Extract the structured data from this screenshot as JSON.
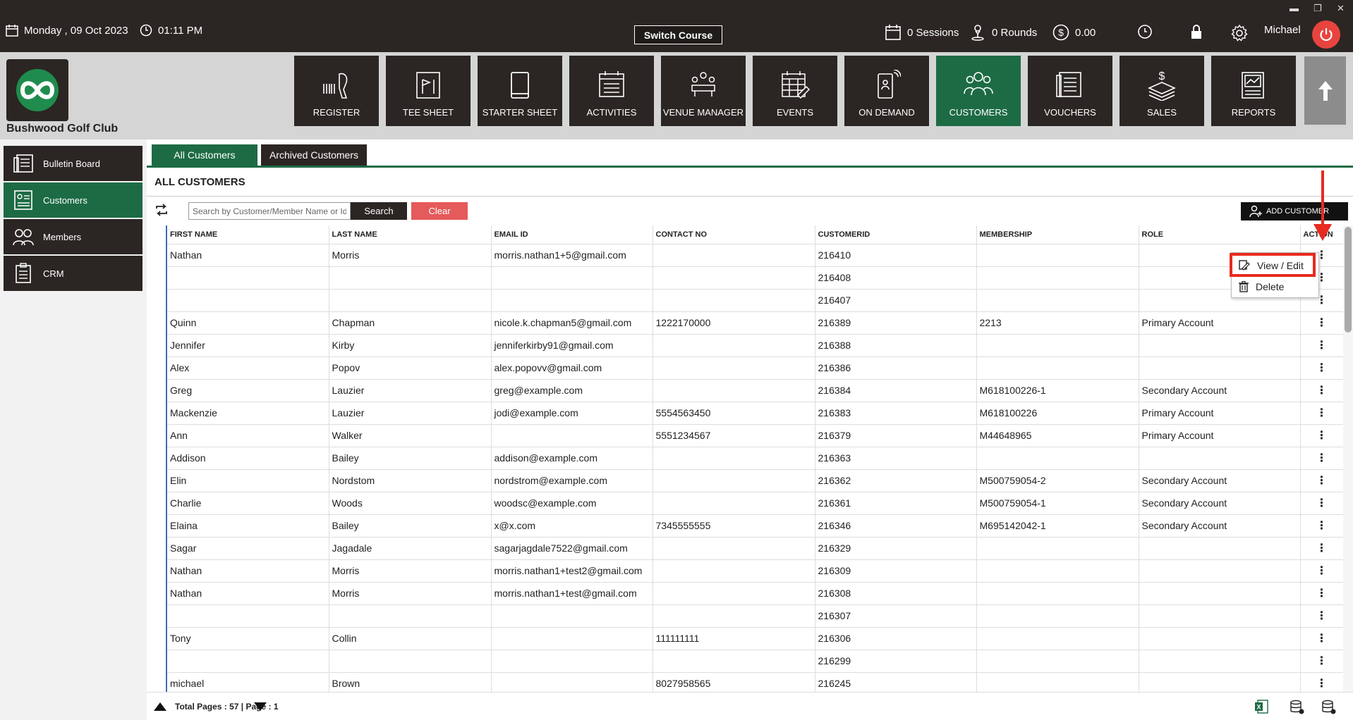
{
  "topbar": {
    "date": "Monday ,  09 Oct 2023",
    "time": "01:11 PM",
    "switch_course": "Switch Course",
    "sessions": "0 Sessions",
    "rounds": "0 Rounds",
    "amount": "0.00",
    "user": "Michael",
    "win_min": "▬",
    "win_restore": "❐",
    "win_close": "✕"
  },
  "club_name": "Bushwood Golf Club",
  "nav": [
    {
      "label": "REGISTER",
      "icon": "barcode-scanner-icon"
    },
    {
      "label": "TEE SHEET",
      "icon": "tee-sheet-icon"
    },
    {
      "label": "STARTER SHEET",
      "icon": "tablet-icon"
    },
    {
      "label": "ACTIVITIES",
      "icon": "calendar-list-icon"
    },
    {
      "label": "VENUE MANAGER",
      "icon": "venue-icon"
    },
    {
      "label": "EVENTS",
      "icon": "events-calendar-icon"
    },
    {
      "label": "ON DEMAND",
      "icon": "phone-icon"
    },
    {
      "label": "CUSTOMERS",
      "icon": "customers-icon",
      "active": true
    },
    {
      "label": "VOUCHERS",
      "icon": "vouchers-icon"
    },
    {
      "label": "SALES",
      "icon": "sales-icon"
    },
    {
      "label": "REPORTS",
      "icon": "reports-icon"
    }
  ],
  "sidebar": {
    "items": [
      {
        "label": "Bulletin Board",
        "icon": "bulletin-icon"
      },
      {
        "label": "Customers",
        "icon": "customers-list-icon",
        "active": true
      },
      {
        "label": "Members",
        "icon": "members-icon"
      },
      {
        "label": "CRM",
        "icon": "crm-icon"
      }
    ]
  },
  "tabs": {
    "all": "All Customers",
    "archived": "Archived Customers"
  },
  "section_title": "ALL CUSTOMERS",
  "search": {
    "placeholder": "Search by Customer/Member Name or Id",
    "button": "Search",
    "clear": "Clear"
  },
  "add_customer": "ADD CUSTOMER",
  "table": {
    "headers": [
      "FIRST NAME",
      "LAST NAME",
      "EMAIL ID",
      "CONTACT NO",
      "CUSTOMERID",
      "MEMBERSHIP",
      "ROLE",
      "ACTION"
    ],
    "rows": [
      [
        "Nathan",
        "Morris",
        "morris.nathan1+5@gmail.com",
        "",
        "216410",
        "",
        ""
      ],
      [
        "",
        "",
        "",
        "",
        "216408",
        "",
        ""
      ],
      [
        "",
        "",
        "",
        "",
        "216407",
        "",
        ""
      ],
      [
        "Quinn",
        "Chapman",
        "nicole.k.chapman5@gmail.com",
        "1222170000",
        "216389",
        "2213",
        "Primary Account"
      ],
      [
        "Jennifer",
        "Kirby",
        "jenniferkirby91@gmail.com",
        "",
        "216388",
        "",
        ""
      ],
      [
        "Alex",
        "Popov",
        "alex.popovv@gmail.com",
        "",
        "216386",
        "",
        ""
      ],
      [
        "Greg",
        "Lauzier",
        "greg@example.com",
        "",
        "216384",
        "M618100226-1",
        "Secondary Account"
      ],
      [
        "Mackenzie",
        "Lauzier",
        "jodi@example.com",
        "5554563450",
        "216383",
        "M618100226",
        "Primary Account"
      ],
      [
        "Ann",
        "Walker",
        "",
        "5551234567",
        "216379",
        "M44648965",
        "Primary Account"
      ],
      [
        "Addison",
        "Bailey",
        "addison@example.com",
        "",
        "216363",
        "",
        ""
      ],
      [
        "Elin",
        "Nordstom",
        "nordstrom@example.com",
        "",
        "216362",
        "M500759054-2",
        "Secondary Account"
      ],
      [
        "Charlie",
        "Woods",
        "woodsc@example.com",
        "",
        "216361",
        "M500759054-1",
        "Secondary Account"
      ],
      [
        "Elaina",
        "Bailey",
        "x@x.com",
        "7345555555",
        "216346",
        "M695142042-1",
        "Secondary Account"
      ],
      [
        "Sagar",
        "Jagadale",
        "sagarjagdale7522@gmail.com",
        "",
        "216329",
        "",
        ""
      ],
      [
        "Nathan",
        "Morris",
        "morris.nathan1+test2@gmail.com",
        "",
        "216309",
        "",
        ""
      ],
      [
        "Nathan",
        "Morris",
        "morris.nathan1+test@gmail.com",
        "",
        "216308",
        "",
        ""
      ],
      [
        "",
        "",
        "",
        "",
        "216307",
        "",
        ""
      ],
      [
        "Tony",
        "Collin",
        "",
        "111111111",
        "216306",
        "",
        ""
      ],
      [
        "",
        "",
        "",
        "",
        "216299",
        "",
        ""
      ],
      [
        "michael",
        "Brown",
        "",
        "8027958565",
        "216245",
        "",
        ""
      ]
    ],
    "action_glyph": "⋮"
  },
  "context_menu": {
    "view_edit": "View / Edit",
    "delete": "Delete"
  },
  "footer": {
    "pager": "Total Pages : 57 | Page : 1"
  },
  "colors": {
    "dark": "#2b2623",
    "accent_green": "#1d6b45",
    "clear_red": "#e55a5a",
    "highlight_red": "#e82a1f"
  }
}
